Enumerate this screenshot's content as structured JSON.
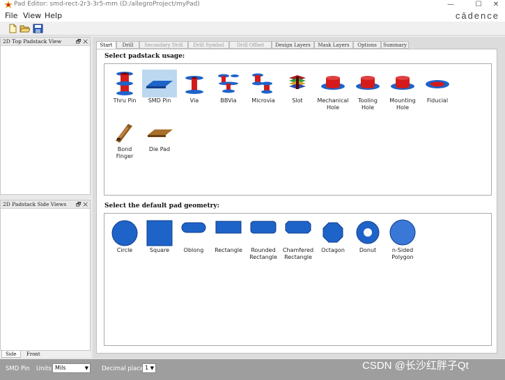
{
  "window": {
    "title": "Pad Editor: smd-rect-2r3-3r5-mm  (D:/allegroProject/myPad)",
    "brand": "cādence",
    "controls": {
      "minimize": "—",
      "maximize": "☐",
      "close": "✕"
    }
  },
  "menu": [
    "File",
    "View",
    "Help"
  ],
  "toolbar": {
    "icons": [
      "new-file-icon",
      "open-folder-icon",
      "save-icon"
    ]
  },
  "left_panels": {
    "top_view": {
      "title": "2D Top Padstack View",
      "controls": "🗗 ✕"
    },
    "side_view": {
      "title": "2D Padstack Side Views",
      "controls": "🗗 ✕"
    },
    "bottom_tabs": [
      "Side",
      "Front"
    ]
  },
  "tabs": [
    {
      "label": "Start",
      "state": "active"
    },
    {
      "label": "Drill",
      "state": "normal"
    },
    {
      "label": "Secondary Drill",
      "state": "disabled"
    },
    {
      "label": "Drill Symbol",
      "state": "disabled"
    },
    {
      "label": "Drill Offset",
      "state": "disabled"
    },
    {
      "label": "Design Layers",
      "state": "normal"
    },
    {
      "label": "Mask Layers",
      "state": "normal"
    },
    {
      "label": "Options",
      "state": "normal"
    },
    {
      "label": "Summary",
      "state": "normal"
    }
  ],
  "usage": {
    "title": "Select padstack usage:",
    "items": [
      {
        "label": "Thru Pin",
        "icon": "thru-pin-icon",
        "selected": false
      },
      {
        "label": "SMD Pin",
        "icon": "smd-pin-icon",
        "selected": true
      },
      {
        "label": "Via",
        "icon": "via-icon",
        "selected": false
      },
      {
        "label": "BBVia",
        "icon": "bbvia-icon",
        "selected": false
      },
      {
        "label": "Microvia",
        "icon": "microvia-icon",
        "selected": false
      },
      {
        "label": "Slot",
        "icon": "slot-icon",
        "selected": false
      },
      {
        "label": "Mechanical\nHole",
        "icon": "mechanical-hole-icon",
        "selected": false
      },
      {
        "label": "Tooling\nHole",
        "icon": "tooling-hole-icon",
        "selected": false
      },
      {
        "label": "Mounting\nHole",
        "icon": "mounting-hole-icon",
        "selected": false
      },
      {
        "label": "Fiducial",
        "icon": "fiducial-icon",
        "selected": false
      },
      {
        "label": "Bond\nFinger",
        "icon": "bond-finger-icon",
        "selected": false
      },
      {
        "label": "Die Pad",
        "icon": "die-pad-icon",
        "selected": false
      }
    ]
  },
  "geometry": {
    "title": "Select the default pad geometry:",
    "items": [
      {
        "label": "Circle",
        "icon": "circle-shape-icon"
      },
      {
        "label": "Square",
        "icon": "square-shape-icon"
      },
      {
        "label": "Oblong",
        "icon": "oblong-shape-icon"
      },
      {
        "label": "Rectangle",
        "icon": "rectangle-shape-icon"
      },
      {
        "label": "Rounded\nRectangle",
        "icon": "rounded-rectangle-shape-icon"
      },
      {
        "label": "Chamfered\nRectangle",
        "icon": "chamfered-rectangle-shape-icon"
      },
      {
        "label": "Octagon",
        "icon": "octagon-shape-icon"
      },
      {
        "label": "Donut",
        "icon": "donut-shape-icon"
      },
      {
        "label": "n-Sided\nPolygon",
        "icon": "n-sided-polygon-shape-icon"
      }
    ]
  },
  "status": {
    "mode": "SMD Pin",
    "units_label": "Units:",
    "units_value": "Mils",
    "decimal_label": "Decimal places:",
    "decimal_value": "1"
  },
  "watermark": "CSDN @长沙红胖子Qt",
  "colors": {
    "pad_blue": "#1e63c8",
    "pin_red": "#d41a1a",
    "selection": "#bcd8f0"
  }
}
